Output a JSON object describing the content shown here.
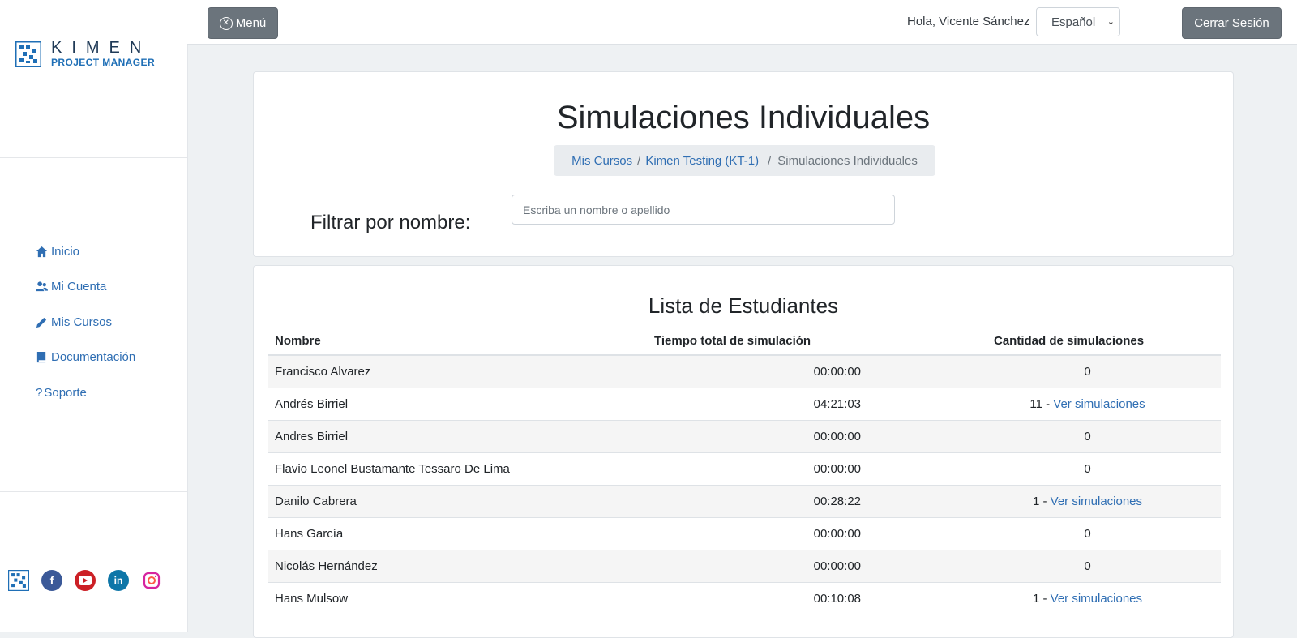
{
  "sidebar": {
    "logo": {
      "line1": "KIMEN",
      "line2": "PROJECT MANAGER"
    },
    "nav": [
      {
        "label": "Inicio",
        "icon": "home-icon"
      },
      {
        "label": "Mi Cuenta",
        "icon": "users-icon"
      },
      {
        "label": "Mis Cursos",
        "icon": "pencil-icon"
      },
      {
        "label": "Documentación",
        "icon": "book-icon"
      },
      {
        "label": "Soporte",
        "icon": "question-icon"
      }
    ],
    "social": [
      "kimen-icon",
      "facebook-icon",
      "youtube-icon",
      "linkedin-icon",
      "instagram-icon"
    ]
  },
  "topbar": {
    "menu_label": "Menú",
    "greeting": "Hola, Vicente Sánchez",
    "language": "Español",
    "logout_label": "Cerrar Sesión"
  },
  "header": {
    "title": "Simulaciones Individuales",
    "breadcrumb": [
      "Mis Cursos",
      "Kimen Testing (KT-1)",
      "Simulaciones Individuales"
    ],
    "filter_label": "Filtrar por nombre:",
    "filter_placeholder": "Escriba un nombre o apellido"
  },
  "students": {
    "title": "Lista de Estudiantes",
    "columns": [
      "Nombre",
      "Tiempo total de simulación",
      "Cantidad de simulaciones"
    ],
    "link_label": "Ver simulaciones",
    "rows": [
      {
        "name": "Francisco Alvarez",
        "time": "00:00:00",
        "count": "0",
        "link": false
      },
      {
        "name": "Andrés Birriel",
        "time": "04:21:03",
        "count": "11",
        "link": true
      },
      {
        "name": "Andres Birriel",
        "time": "00:00:00",
        "count": "0",
        "link": false
      },
      {
        "name": "Flavio Leonel Bustamante Tessaro De Lima",
        "time": "00:00:00",
        "count": "0",
        "link": false
      },
      {
        "name": "Danilo Cabrera",
        "time": "00:28:22",
        "count": "1",
        "link": true
      },
      {
        "name": "Hans García",
        "time": "00:00:00",
        "count": "0",
        "link": false
      },
      {
        "name": "Nicolás Hernández",
        "time": "00:00:00",
        "count": "0",
        "link": false
      },
      {
        "name": "Hans Mulsow",
        "time": "00:10:08",
        "count": "1",
        "link": true
      }
    ]
  },
  "colors": {
    "link": "#2f6eb3",
    "button": "#6b747c",
    "background": "#eef1f3"
  }
}
